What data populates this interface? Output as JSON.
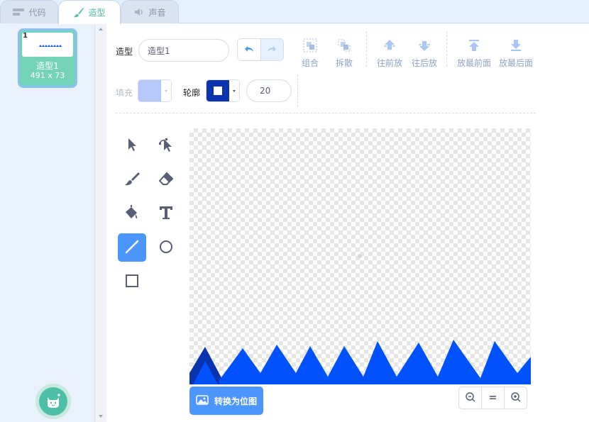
{
  "tabs": [
    {
      "label": "代码"
    },
    {
      "label": "造型"
    },
    {
      "label": "声音"
    }
  ],
  "costume": {
    "index": "1",
    "name": "造型1",
    "size": "491 x 73"
  },
  "toolbar": {
    "costume_label": "造型",
    "costume_name_value": "造型1",
    "group": "组合",
    "ungroup": "拆散",
    "forward": "往前放",
    "backward": "往后放",
    "front": "放最前面",
    "back": "放最后面",
    "fill_label": "填充",
    "outline_label": "轮廓",
    "outline_width": "20"
  },
  "colors": {
    "accent": "#4c97ff",
    "fill_swatch": "#b6c9fb",
    "outline_swatch": "#0a33b0",
    "shape_blue": "#0051ff",
    "shape_dark": "#0a33b0",
    "tab_active": "#4cbfa6"
  },
  "tools": [
    "select",
    "reshape",
    "brush",
    "eraser",
    "fill",
    "text",
    "line",
    "circle",
    "rectangle"
  ],
  "selected_tool": "line",
  "convert_button": "转换为位图",
  "zoom": {
    "out": "zoom-out-icon",
    "reset": "=",
    "in": "zoom-in-icon"
  }
}
